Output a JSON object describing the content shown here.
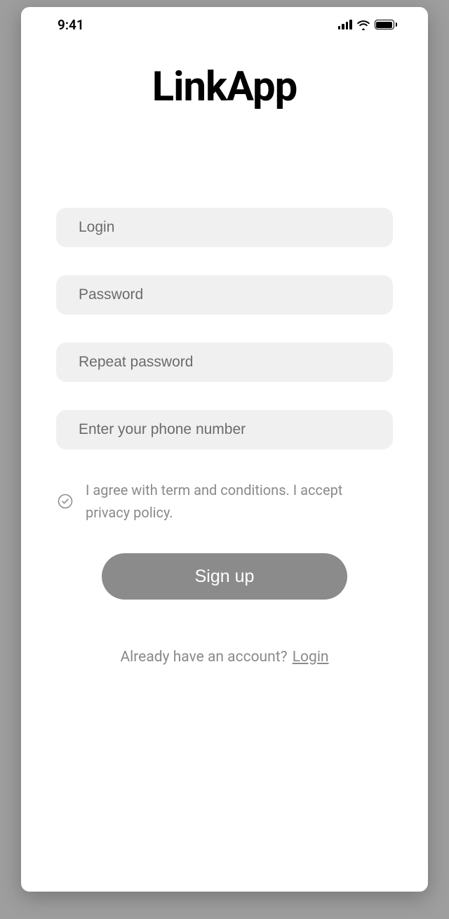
{
  "status": {
    "time": "9:41"
  },
  "app": {
    "title": "LinkApp"
  },
  "form": {
    "login_placeholder": "Login",
    "password_placeholder": "Password",
    "repeat_password_placeholder": "Repeat password",
    "phone_placeholder": "Enter your phone number",
    "terms_text": "I agree with term and conditions. I accept privacy policy.",
    "signup_label": "Sign up"
  },
  "footer": {
    "question": "Already have an account?",
    "login_link": " Login"
  }
}
